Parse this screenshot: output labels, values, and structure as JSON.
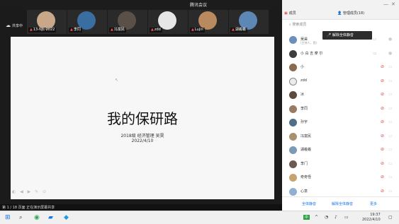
{
  "window": {
    "title": "腾讯会议"
  },
  "video_tiles": [
    {
      "name": "13-NJL 2022"
    },
    {
      "name": "李同"
    },
    {
      "name": "冯富民"
    },
    {
      "name": "zdd"
    },
    {
      "name": "Lujin"
    },
    {
      "name": "湖羲羲"
    }
  ],
  "share": {
    "label": "共享中"
  },
  "slide": {
    "title": "我的保研路",
    "subtitle": "2018级 经济管理 吴昊",
    "date": "2022/4/10"
  },
  "status_bar": {
    "text": "第 1 / 18 页面 正在演示屏幕共享"
  },
  "panel": {
    "tab_label": "成员",
    "count_label": "管理成员(18)",
    "search_placeholder": "搜索成员",
    "tooltip": "解除全体静音",
    "participants": [
      {
        "name": "吴昊",
        "sub": "(主持人，我)"
      },
      {
        "name": "小 白 吉 摩 尔"
      },
      {
        "name": "小"
      },
      {
        "name": "zdd"
      },
      {
        "name": "冰"
      },
      {
        "name": "李同"
      },
      {
        "name": "孙宇"
      },
      {
        "name": "冯富民"
      },
      {
        "name": "湖羲羲"
      },
      {
        "name": "李门"
      },
      {
        "name": "奇奇怪"
      },
      {
        "name": "心意"
      }
    ],
    "footer_buttons": [
      "全体静音",
      "解除全体静音",
      "更多"
    ]
  },
  "taskbar": {
    "tray_badge": "中",
    "time": "19:37",
    "date": "2022/4/10"
  },
  "colors": {
    "accent": "#1a74e8",
    "muted_red": "#d04040",
    "slide_bg": "#f7f7f7"
  }
}
